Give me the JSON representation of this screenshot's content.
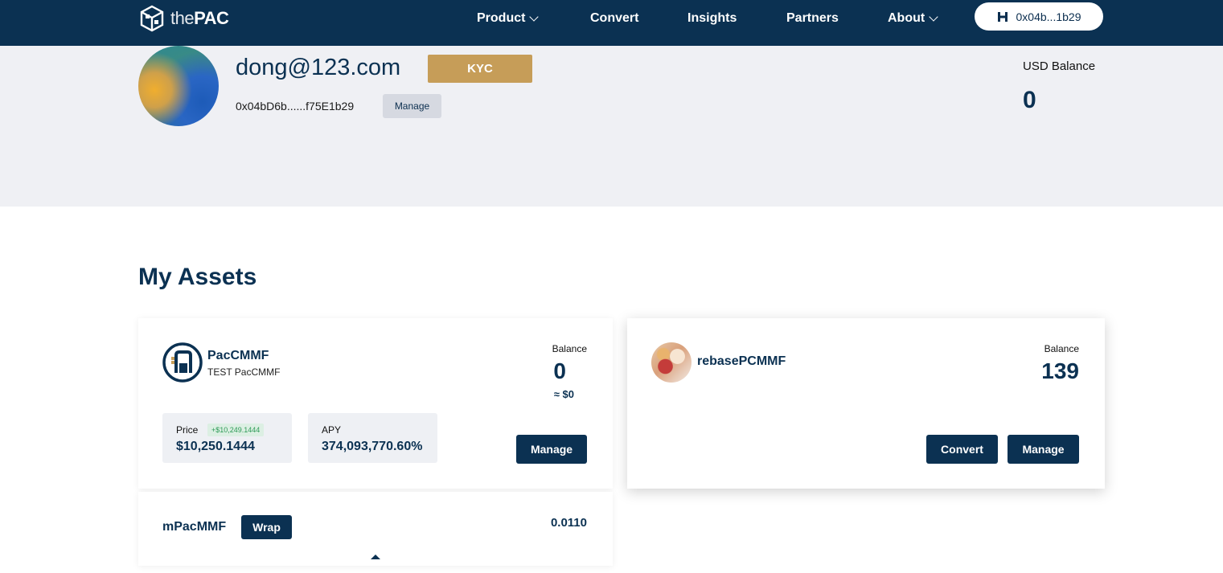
{
  "nav": {
    "logo_the": "the",
    "logo_pac": "PAC",
    "items": [
      {
        "label": "Product",
        "has_dropdown": true
      },
      {
        "label": "Convert",
        "has_dropdown": false
      },
      {
        "label": "Insights",
        "has_dropdown": false
      },
      {
        "label": "Partners",
        "has_dropdown": false
      },
      {
        "label": "About",
        "has_dropdown": true
      }
    ],
    "wallet_label": "0x04b...1b29",
    "wallet_icon": "hashpack-icon"
  },
  "profile": {
    "email": "dong@123.com",
    "kyc_label": "KYC",
    "address": "0x04bD6b......f75E1b29",
    "manage_label": "Manage",
    "usd_balance_label": "USD Balance",
    "usd_balance_value": "0"
  },
  "assets": {
    "title": "My Assets",
    "pac_cmmf": {
      "name": "PacCMMF",
      "subtitle": "TEST PacCMMF",
      "balance_label": "Balance",
      "balance_value": "0",
      "balance_usd": "≈ $0",
      "price_label": "Price",
      "price_change": "+$10,249.1444",
      "price_value": "$10,250.1444",
      "apy_label": "APY",
      "apy_value": "374,093,770.60%",
      "manage_label": "Manage"
    },
    "rebase_pcmmf": {
      "name": "rebasePCMMF",
      "balance_label": "Balance",
      "balance_value": "139",
      "convert_label": "Convert",
      "manage_label": "Manage"
    },
    "m_pac_mmf": {
      "name": "mPacMMF",
      "wrap_label": "Wrap",
      "value": "0.0110"
    }
  },
  "colors": {
    "navy": "#0b3152",
    "kyc_gold": "#c69d58",
    "band_gray": "#eff0f4",
    "positive_green": "#2d9a56"
  }
}
